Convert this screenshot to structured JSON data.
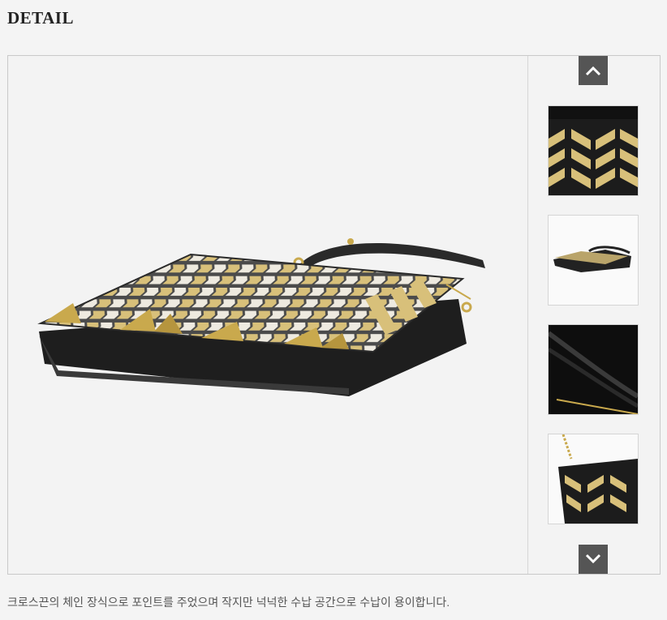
{
  "header": {
    "title": "DETAIL"
  },
  "viewer": {
    "main_image_icon": "crossbody-bag-photo",
    "thumbnails": [
      {
        "icon": "bag-pattern-closeup"
      },
      {
        "icon": "bag-side-view"
      },
      {
        "icon": "bag-interior-view"
      },
      {
        "icon": "bag-chain-closeup"
      }
    ],
    "nav_up_icon": "chevron-up-icon",
    "nav_down_icon": "chevron-down-icon"
  },
  "caption": "크로스끈의 체인 장식으로 포인트를 주었으며 작지만 넉넉한 수납 공간으로 수납이 용이합니다.",
  "colors": {
    "background": "#f4f4f4",
    "nav_button": "#555555",
    "gold": "#c9a94d",
    "leather": "#2a2a2a"
  }
}
